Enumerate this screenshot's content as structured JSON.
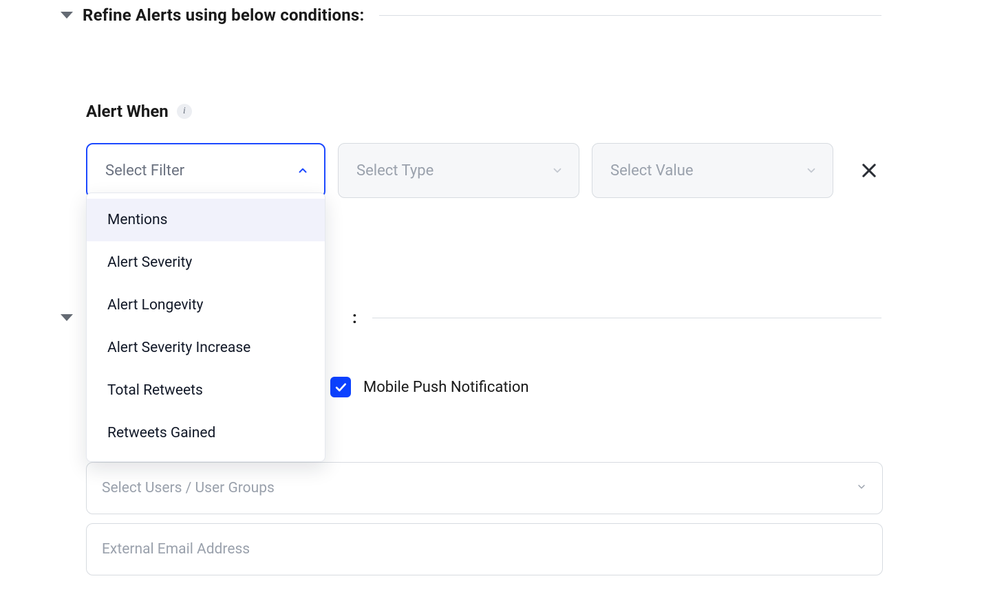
{
  "section1": {
    "title": "Refine Alerts using below conditions:"
  },
  "alertWhen": {
    "label": "Alert When"
  },
  "filters": {
    "filter_placeholder": "Select Filter",
    "type_placeholder": "Select Type",
    "value_placeholder": "Select Value"
  },
  "dropdown": {
    "items": [
      "Mentions",
      "Alert Severity",
      "Alert Longevity",
      "Alert Severity Increase",
      "Total Retweets",
      "Retweets Gained"
    ],
    "highlighted_index": 0
  },
  "section2": {
    "trailing": ":"
  },
  "mobile": {
    "checked": true,
    "label": "Mobile Push Notification"
  },
  "users_placeholder": "Select Users / User Groups",
  "email_placeholder": "External Email Address"
}
